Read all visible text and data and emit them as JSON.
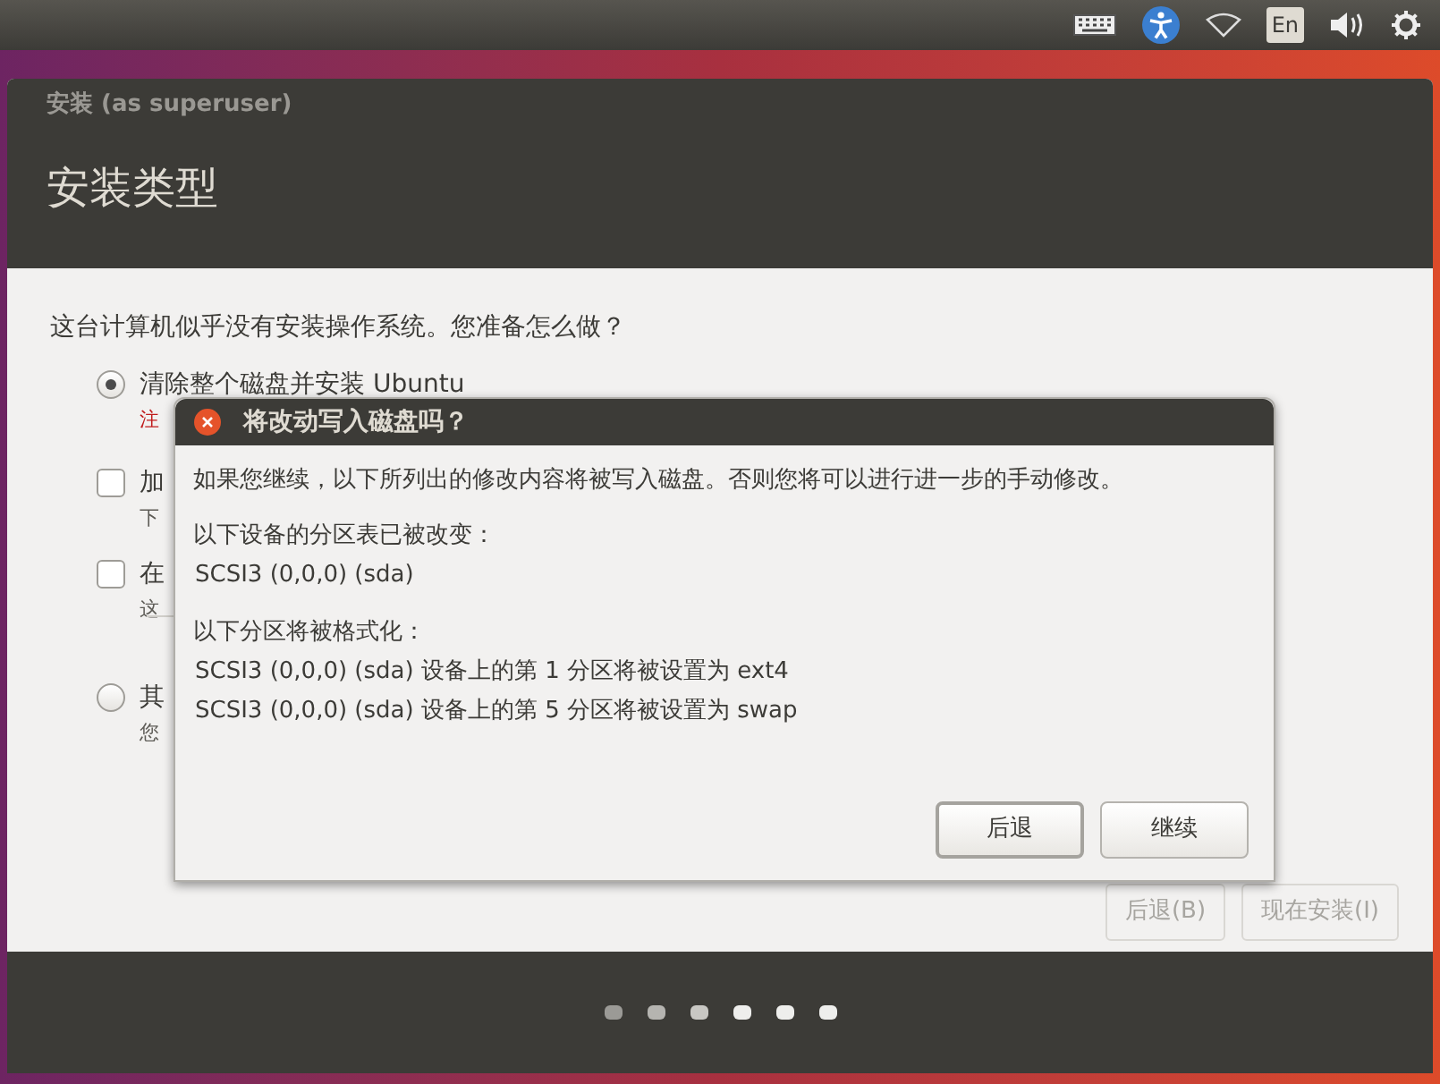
{
  "top_panel": {
    "language": "En"
  },
  "window": {
    "title": "安装 (as superuser)",
    "heading": "安装类型"
  },
  "question": "这台计算机似乎没有安装操作系统。您准备怎么做？",
  "options": [
    {
      "kind": "radio",
      "label": "清除整个磁盘并安装 Ubuntu",
      "note": "注",
      "warning": true,
      "selected": true
    },
    {
      "kind": "checkbox",
      "label": "加",
      "note": "下",
      "warning": false,
      "checked": false
    },
    {
      "kind": "checkbox",
      "label": "在",
      "note": "这",
      "warning": false,
      "checked": false
    },
    {
      "kind": "radio",
      "label": "其",
      "note": "您",
      "warning": false,
      "selected": false
    }
  ],
  "buttons": [
    {
      "label": "后退(B)",
      "disabled": true
    },
    {
      "label": "现在安装(I)",
      "disabled": true
    }
  ],
  "dialog": {
    "title": "将改动写入磁盘吗？",
    "message": "如果您继续，以下所列出的修改内容将被写入磁盘。否则您将可以进行进一步的手动修改。",
    "sections": [
      {
        "heading": "以下设备的分区表已被改变：",
        "items": [
          "SCSI3 (0,0,0) (sda)"
        ]
      },
      {
        "heading": "以下分区将被格式化：",
        "items": [
          "SCSI3 (0,0,0) (sda) 设备上的第 1 分区将被设置为 ext4",
          "SCSI3 (0,0,0) (sda) 设备上的第 5 分区将被设置为 swap"
        ]
      }
    ],
    "buttons": [
      {
        "label": "后退",
        "default": true
      },
      {
        "label": "继续",
        "default": false
      }
    ]
  }
}
